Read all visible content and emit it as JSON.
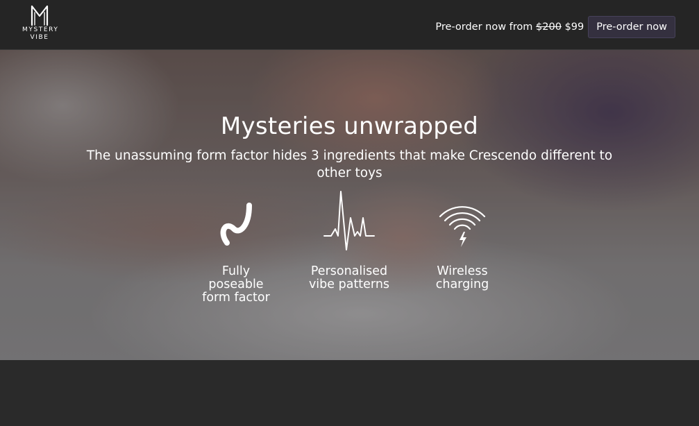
{
  "brand": {
    "logo_icon": "m-letter-logo-icon",
    "line1": "MYSTERY",
    "line2": "VIBE"
  },
  "header": {
    "preorder_prefix": "Pre-order now from",
    "old_price": "$200",
    "new_price": "$99",
    "preorder_button": "Pre-order now"
  },
  "hero": {
    "title": "Mysteries unwrapped",
    "subtitle": "The unassuming form factor hides 3 ingredients that make Crescendo different to other toys",
    "features": [
      {
        "icon": "bendable-curve-icon",
        "label_lines": [
          "Fully",
          "poseable",
          "form factor"
        ]
      },
      {
        "icon": "heartbeat-pulse-icon",
        "label_lines": [
          "Personalised",
          "vibe patterns"
        ]
      },
      {
        "icon": "wireless-charging-icon",
        "label_lines": [
          "Wireless",
          "charging"
        ]
      }
    ]
  },
  "colors": {
    "nav_background": "#252525",
    "button_background": "#34303f",
    "text": "#ffffff",
    "page_background": "#2a2a2a"
  }
}
